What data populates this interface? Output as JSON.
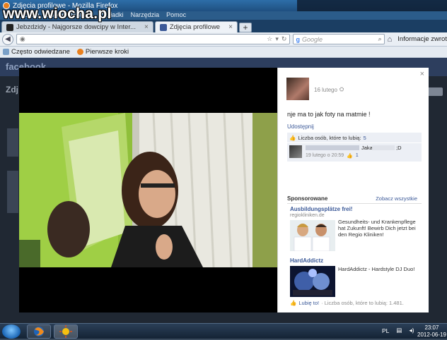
{
  "watermark": "www.wiocha.pl",
  "window": {
    "title": "Zdjęcia profilowe - Mozilla Firefox"
  },
  "menubar": [
    "Plik",
    "Edycja",
    "Widok",
    "Historia",
    "Zakładki",
    "Narzędzia",
    "Pomoc"
  ],
  "tabs": [
    {
      "label": "Jebzdzidy - Najgorsze dowcipy w Inter..."
    },
    {
      "label": "Zdjęcia profilowe",
      "active": true
    }
  ],
  "navbar": {
    "search_placeholder": "Google",
    "info_label": "Informacje zwrot"
  },
  "bookmarks": [
    {
      "label": "Często odwiedzane",
      "icon": "page-icon"
    },
    {
      "label": "Pierwsze kroki",
      "icon": "firefox-icon"
    }
  ],
  "background_page": {
    "logo": "facebook",
    "title": "Zdj"
  },
  "photo_panel": {
    "close": "×",
    "date": "16 lutego",
    "caption": "nje ma to jak foty na matmie !",
    "share": "Udostępnij",
    "likes_label": "Liczba osób, które to lubią:",
    "likes_count": "5",
    "comment": {
      "text": "Jaka",
      "smile": ";D",
      "date": "19 lutego o 20:59",
      "likes": "1"
    }
  },
  "sponsored": {
    "title": "Sponsorowane",
    "see_all": "Zobacz wszystkie",
    "ads": [
      {
        "title": "Ausbildungsplätze frei!",
        "url": "regiokliniken.de",
        "text": "Gesundheits- und Krankenpflege hat Zukunft! Bewirb Dich jetzt bei den Regio Kliniken!"
      },
      {
        "title": "HardAddictz",
        "text": "HardAddictz - Hardstyle DJ Duo!"
      }
    ],
    "footer": {
      "like": "Lubię to!",
      "label": "· Liczba osób, które to lubią: 1.481."
    }
  },
  "taskbar": {
    "lang": "PL",
    "time": "23:07",
    "date": "2012-06-19"
  },
  "colors": {
    "fb_blue": "#3b5998",
    "taskbar": "#142335"
  }
}
